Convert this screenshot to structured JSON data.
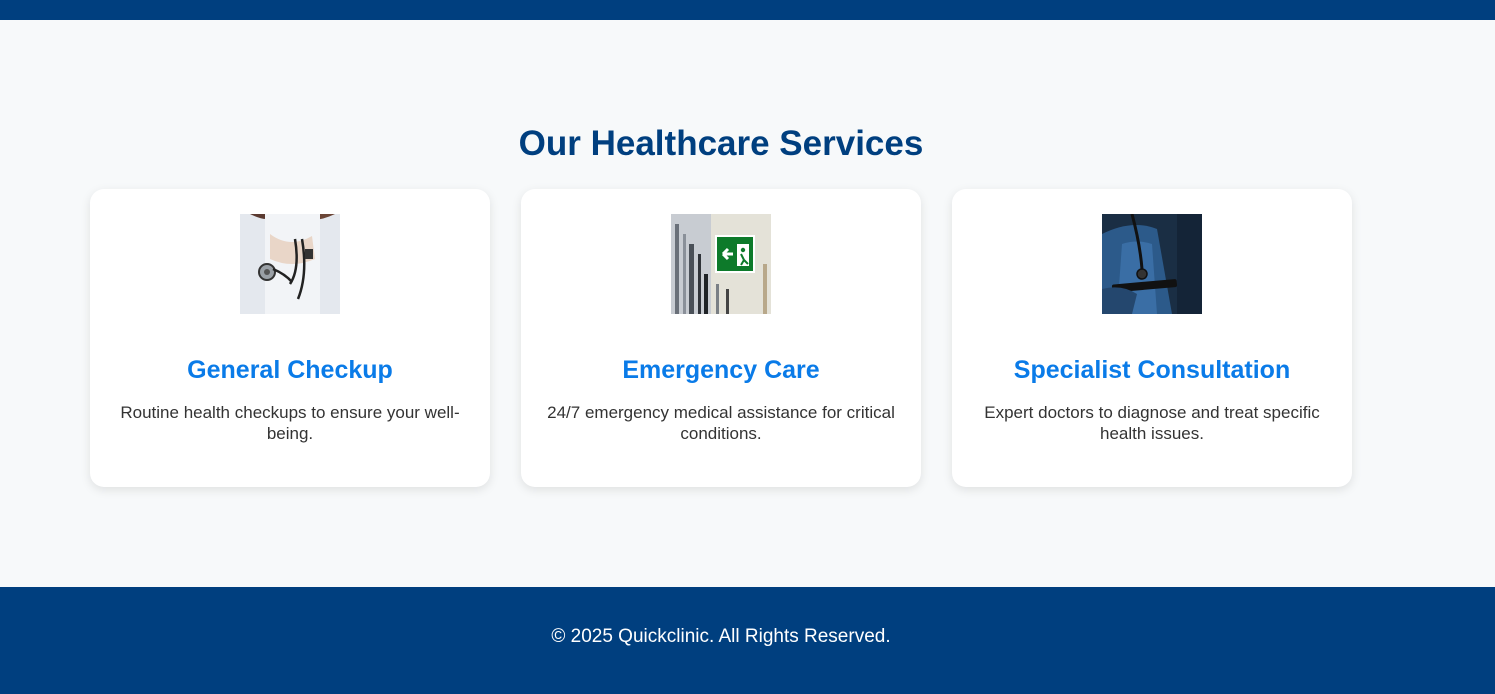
{
  "services": {
    "title": "Our Healthcare Services",
    "cards": [
      {
        "image": "doctor-with-stethoscope-photo",
        "title": "General Checkup",
        "description": "Routine health checkups to ensure your well-being."
      },
      {
        "image": "emergency-exit-sign-photo",
        "title": "Emergency Care",
        "description": "24/7 emergency medical assistance for critical conditions."
      },
      {
        "image": "doctor-in-scrubs-with-tablet-photo",
        "title": "Specialist Consultation",
        "description": "Expert doctors to diagnose and treat specific health issues."
      }
    ]
  },
  "footer": {
    "copyright": "© 2025 Quickclinic. All Rights Reserved."
  },
  "colors": {
    "primary_dark": "#003f7f",
    "accent_blue": "#0a7be8",
    "background": "#f7f9fa",
    "card_bg": "#ffffff",
    "body_text": "#333333"
  }
}
